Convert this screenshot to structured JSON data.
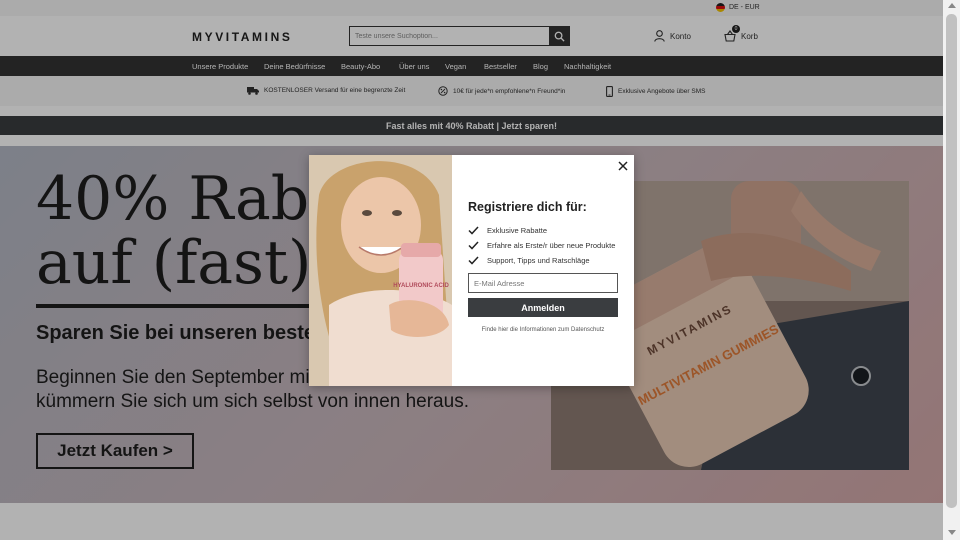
{
  "locale": {
    "label": "DE - EUR",
    "flag_icon": "germany-flag-icon"
  },
  "header": {
    "logo": "MYVITAMINS",
    "search_placeholder": "Teste unsere Suchoption...",
    "account_label": "Konto",
    "cart_label": "Korb",
    "cart_count": "0"
  },
  "nav": {
    "items": [
      "Unsere Produkte",
      "Deine Bedürfnisse",
      "Beauty-Abo",
      "Über uns",
      "Vegan",
      "Bestseller",
      "Blog",
      "Nachhaltigkeit"
    ]
  },
  "benefits": [
    {
      "icon": "truck-icon",
      "text": "KOSTENLOSER Versand für eine begrenzte Zeit"
    },
    {
      "icon": "discount-badge-icon",
      "text": "10€ für jede*n empfohlene*n Freund*in"
    },
    {
      "icon": "smartphone-icon",
      "text": "Exklusive Angebote über SMS"
    }
  ],
  "promo_bar": "Fast alles mit 40% Rabatt | Jetzt sparen!",
  "hero": {
    "headline_line1": "40% Rabatt",
    "headline_line2": "auf (fast) alles",
    "subheadline": "Sparen Sie bei unseren besten Produkten",
    "body_line1": "Beginnen Sie den September mit Vitaminen und",
    "body_line2": "kümmern Sie sich um sich selbst von innen heraus.",
    "cta": "Jetzt Kaufen >",
    "product_label_1": "MYVITAMINS",
    "product_label_2": "MULTIVITAMIN GUMMIES"
  },
  "modal": {
    "title": "Registriere dich für:",
    "benefits": [
      "Exklusive Rabatte",
      "Erfahre als Erste/r über neue Produkte",
      "Support, Tipps und Ratschläge"
    ],
    "email_placeholder": "E-Mail Adresse",
    "submit_label": "Anmelden",
    "privacy_link": "Finde hier die Informationen zum Datenschutz",
    "product_label": "HYALURONIC ACID"
  },
  "colors": {
    "nav_bg": "#333333",
    "promo_bg": "#3a3d40",
    "button_bg": "#3a3d40",
    "page_bg": "#ffffff"
  }
}
